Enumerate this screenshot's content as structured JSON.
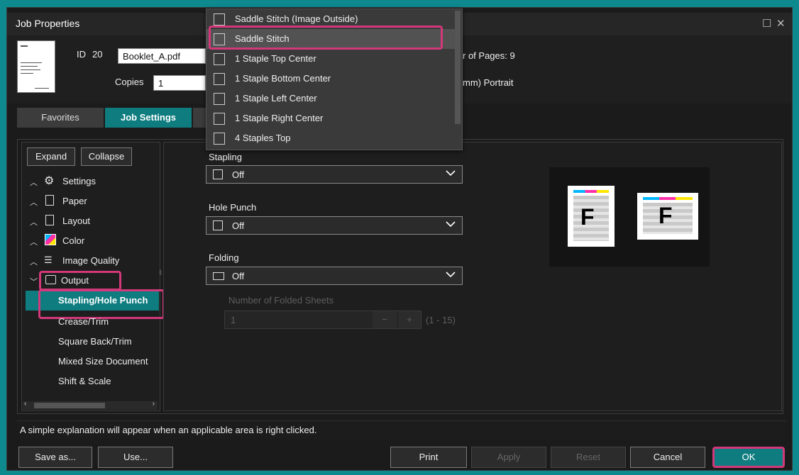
{
  "window": {
    "title": "Job Properties"
  },
  "job": {
    "id_label": "ID",
    "id_value": "20",
    "file_name": "Booklet_A.pdf",
    "copies_label": "Copies",
    "copies_value": "1",
    "pages_text": "r of Pages:  9",
    "orientation_text": "mm) Portrait"
  },
  "tabs": [
    {
      "label": "Favorites"
    },
    {
      "label": "Job Settings"
    }
  ],
  "tree": {
    "expand_label": "Expand",
    "collapse_label": "Collapse",
    "items": [
      {
        "label": "Settings",
        "icon": "gear-icon"
      },
      {
        "label": "Paper",
        "icon": "paper-icon"
      },
      {
        "label": "Layout",
        "icon": "layout-icon"
      },
      {
        "label": "Color",
        "icon": "color-icon"
      },
      {
        "label": "Image Quality",
        "icon": "image-quality-icon"
      },
      {
        "label": "Output",
        "icon": "printer-icon"
      }
    ],
    "sub_items": [
      {
        "label": "Stapling/Hole Punch"
      },
      {
        "label": "Crease/Trim"
      },
      {
        "label": "Square Back/Trim"
      },
      {
        "label": "Mixed Size Document"
      },
      {
        "label": "Shift & Scale"
      }
    ]
  },
  "stapling": {
    "label": "Stapling",
    "value": "Off"
  },
  "hole_punch": {
    "label": "Hole Punch",
    "value": "Off"
  },
  "folding": {
    "label": "Folding",
    "value": "Off",
    "sheets_label": "Number of Folded Sheets",
    "sheets_value": "1",
    "sheets_range": "(1 - 15)"
  },
  "dropdown": {
    "options": [
      {
        "label": "Saddle Stitch (Image Outside)"
      },
      {
        "label": "Saddle Stitch"
      },
      {
        "label": "1 Staple Top Center"
      },
      {
        "label": "1 Staple Bottom Center"
      },
      {
        "label": "1 Staple Left Center"
      },
      {
        "label": "1 Staple Right Center"
      },
      {
        "label": "4 Staples Top"
      }
    ]
  },
  "preview": {
    "letter": "F"
  },
  "status": {
    "text": "A simple explanation will appear when an applicable area is right clicked."
  },
  "footer": {
    "save_as": "Save as...",
    "use": "Use...",
    "print": "Print",
    "apply": "Apply",
    "reset": "Reset",
    "cancel": "Cancel",
    "ok": "OK"
  },
  "colors": {
    "accent": "#0f7d80",
    "highlight": "#d2387a",
    "background": "#1b1b1b"
  }
}
